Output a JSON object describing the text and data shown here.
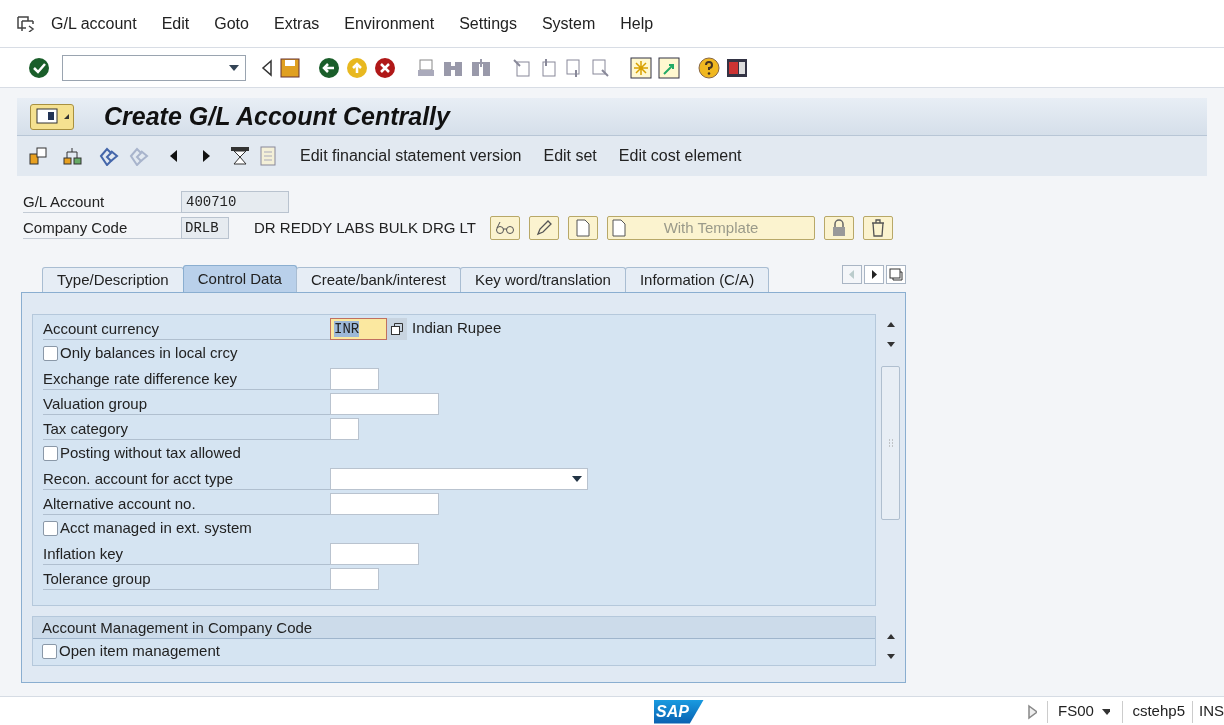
{
  "menu": [
    "G/L account",
    "Edit",
    "Goto",
    "Extras",
    "Environment",
    "Settings",
    "System",
    "Help"
  ],
  "title": "Create G/L Account Centrally",
  "app_toolbar": [
    "Edit financial statement version",
    "Edit set",
    "Edit cost element"
  ],
  "header": {
    "gl_account": {
      "label": "G/L Account",
      "value": "400710"
    },
    "company_code": {
      "label": "Company Code",
      "value": "DRLB",
      "name": "DR REDDY LABS BULK DRG LT"
    },
    "template_button": {
      "label": "With Template",
      "disabled": true
    }
  },
  "tabs": [
    {
      "label": "Type/Description",
      "selected": false
    },
    {
      "label": "Control Data",
      "selected": true
    },
    {
      "label": "Create/bank/interest",
      "selected": false
    },
    {
      "label": "Key word/translation",
      "selected": false
    },
    {
      "label": "Information (C/A)",
      "selected": false
    }
  ],
  "fields": [
    {
      "kind": "currency",
      "label": "Account currency",
      "value": "INR",
      "description": "Indian Rupee"
    },
    {
      "kind": "checkbox",
      "label": "Only balances in local crcy",
      "checked": false
    },
    {
      "kind": "field",
      "label": "Exchange rate difference key"
    },
    {
      "kind": "field",
      "label": "Valuation group"
    },
    {
      "kind": "field",
      "label": "Tax category"
    },
    {
      "kind": "checkbox",
      "label": "Posting without tax allowed",
      "checked": false
    },
    {
      "kind": "dropdown",
      "label": "Recon. account for acct type"
    },
    {
      "kind": "field",
      "label": "Alternative account no."
    },
    {
      "kind": "checkbox",
      "label": "Acct managed in ext. system",
      "checked": false
    },
    {
      "kind": "field",
      "label": "Inflation key"
    },
    {
      "kind": "field",
      "label": "Tolerance group"
    }
  ],
  "section2": {
    "title": "Account Management in Company Code",
    "fields": [
      {
        "kind": "checkbox",
        "label": "Open item management",
        "checked": false
      }
    ]
  },
  "status_bar": {
    "logo": "SAP",
    "transaction": "FS00",
    "server": "cstehp5",
    "mode": "INS"
  }
}
